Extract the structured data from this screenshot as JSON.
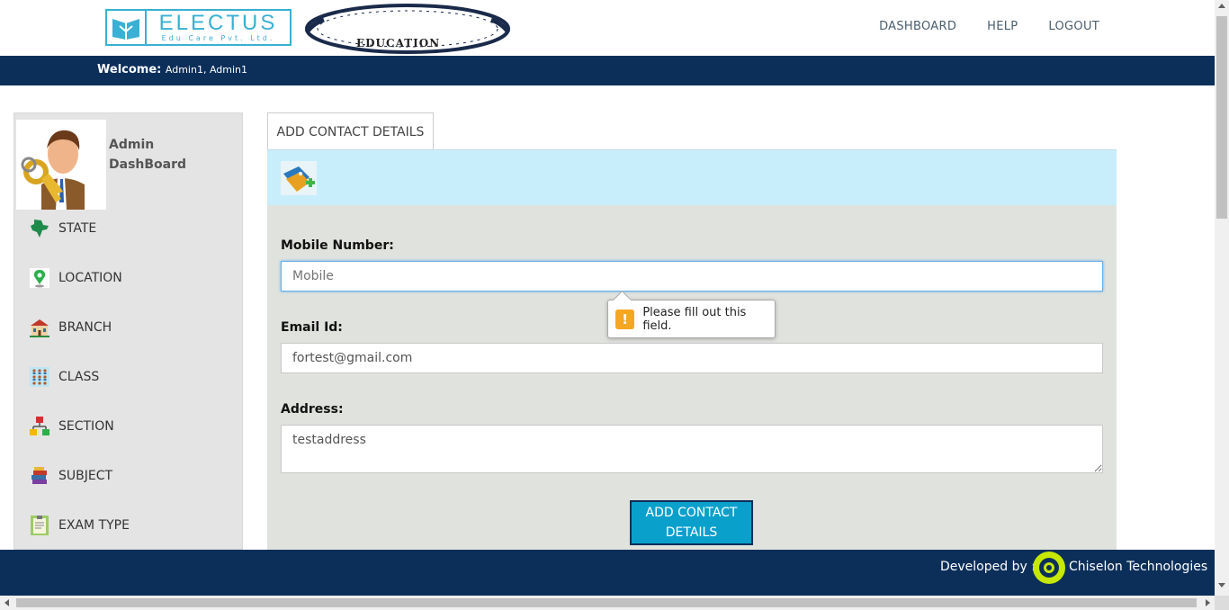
{
  "header": {
    "logo_name": "ELECTUS",
    "logo_sub": "Edu Care Pvt. Ltd.",
    "edu_logo_text": "EDUCATION",
    "nav": [
      "DASHBOARD",
      "HELP",
      "LOGOUT"
    ]
  },
  "welcome": {
    "label": "Welcome:",
    "name": "Admin1, Admin1"
  },
  "sidebar": {
    "admin_line1": "Admin",
    "admin_line2": "DashBoard",
    "items": [
      {
        "label": "STATE",
        "icon": "india-map-icon"
      },
      {
        "label": "LOCATION",
        "icon": "location-pin-icon"
      },
      {
        "label": "BRANCH",
        "icon": "building-icon"
      },
      {
        "label": "CLASS",
        "icon": "class-grid-icon"
      },
      {
        "label": "SECTION",
        "icon": "hierarchy-icon"
      },
      {
        "label": "SUBJECT",
        "icon": "books-icon"
      },
      {
        "label": "EXAM TYPE",
        "icon": "clipboard-icon"
      }
    ]
  },
  "main": {
    "tab_label": "ADD CONTACT DETAILS",
    "form": {
      "mobile_label": "Mobile Number:",
      "mobile_value": "",
      "mobile_placeholder": "Mobile",
      "email_label": "Email Id:",
      "email_value": "fortest@gmail.com",
      "address_label": "Address:",
      "address_value": "testaddress",
      "submit_line1": "ADD CONTACT",
      "submit_line2": "DETAILS"
    },
    "validation_tooltip": "Please fill out this field."
  },
  "footer": {
    "developed_by": "Developed by :",
    "company": "Chiselon Technologies"
  },
  "colors": {
    "navy": "#0c2f5a",
    "accent": "#0aa0cc",
    "logo_blue": "#3ab0d4",
    "panel_head": "#c8eefc",
    "panel_body": "#e0e2dd",
    "warning": "#f5a623"
  }
}
